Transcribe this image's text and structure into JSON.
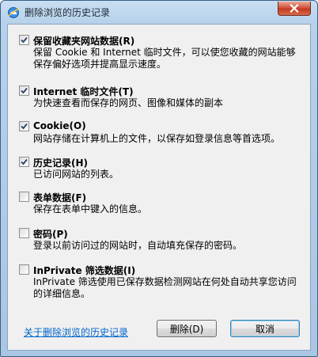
{
  "window": {
    "title": "删除浏览的历史记录"
  },
  "options": [
    {
      "label": "保留收藏夹网站数据(R)",
      "checked": true,
      "description": "保留 Cookie 和 Internet 临时文件，可以使您收藏的网站能够保存偏好选项并提高显示速度。"
    },
    {
      "label": "Internet 临时文件(T)",
      "checked": true,
      "description": "为快速查看而保存的网页、图像和媒体的副本"
    },
    {
      "label": "Cookie(O)",
      "checked": true,
      "description": "网站存储在计算机上的文件，以保存如登录信息等首选项。"
    },
    {
      "label": "历史记录(H)",
      "checked": true,
      "description": "已访问网站的列表。"
    },
    {
      "label": "表单数据(F)",
      "checked": false,
      "description": "保存在表单中键入的信息。"
    },
    {
      "label": "密码(P)",
      "checked": false,
      "description": "登录以前访问过的网站时，自动填充保存的密码。"
    },
    {
      "label": "InPrivate 筛选数据(I)",
      "checked": false,
      "description": "InPrivate 筛选使用已保存数据检测网站在何处自动共享您访问的详细信息。"
    }
  ],
  "footer": {
    "link_text": "关于删除浏览的历史记录",
    "delete_label": "删除(D)",
    "cancel_label": "取消"
  },
  "colors": {
    "link": "#0066cc",
    "close_button": "#c9442c",
    "title_bar": "#b9d1ea"
  }
}
